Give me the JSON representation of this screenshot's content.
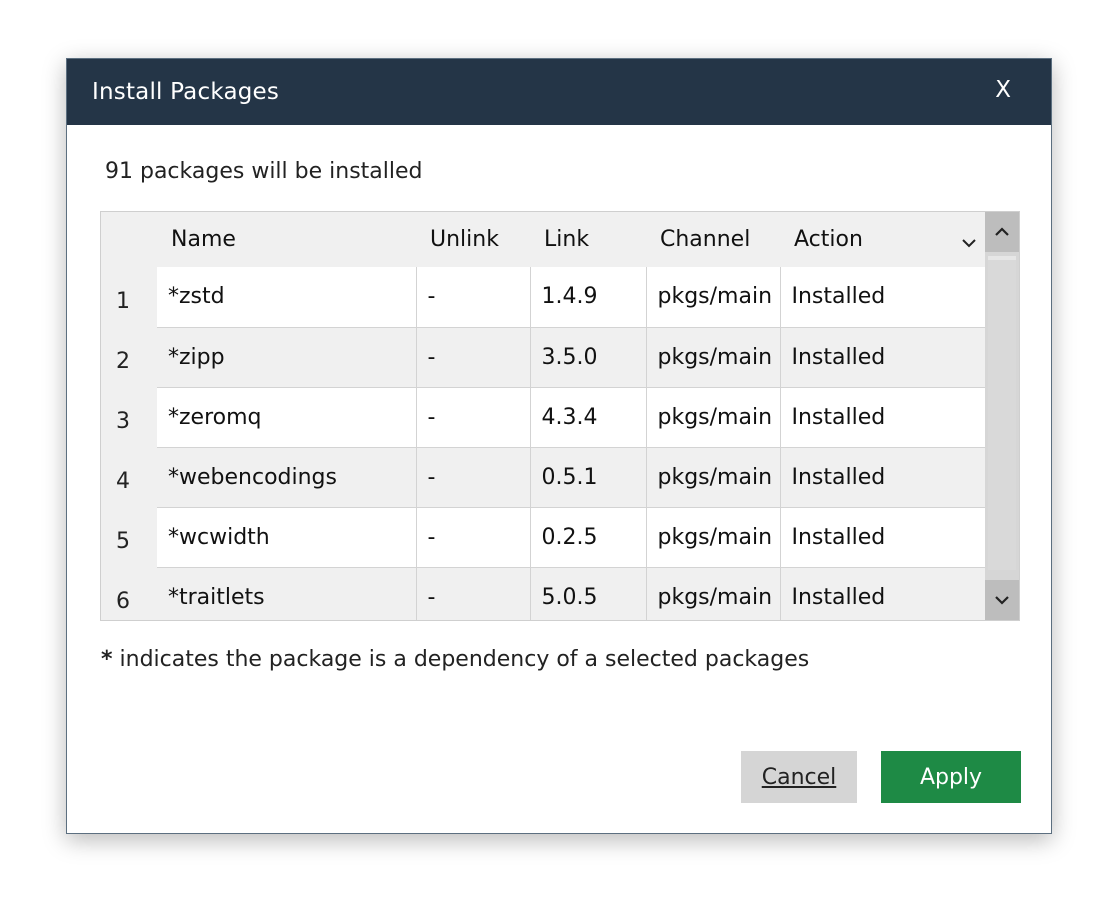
{
  "dialog": {
    "title": "Install Packages",
    "close_label": "X",
    "summary": "91 packages will be installed"
  },
  "table": {
    "columns": [
      "Name",
      "Unlink",
      "Link",
      "Channel",
      "Action"
    ],
    "rows": [
      {
        "num": "1",
        "name": "*zstd",
        "unlink": "-",
        "link": "1.4.9",
        "channel": "pkgs/main",
        "action": "Installed"
      },
      {
        "num": "2",
        "name": "*zipp",
        "unlink": "-",
        "link": "3.5.0",
        "channel": "pkgs/main",
        "action": "Installed"
      },
      {
        "num": "3",
        "name": "*zeromq",
        "unlink": "-",
        "link": "4.3.4",
        "channel": "pkgs/main",
        "action": "Installed"
      },
      {
        "num": "4",
        "name": "*webencodings",
        "unlink": "-",
        "link": "0.5.1",
        "channel": "pkgs/main",
        "action": "Installed"
      },
      {
        "num": "5",
        "name": "*wcwidth",
        "unlink": "-",
        "link": "0.2.5",
        "channel": "pkgs/main",
        "action": "Installed"
      },
      {
        "num": "6",
        "name": "*traitlets",
        "unlink": "-",
        "link": "5.0.5",
        "channel": "pkgs/main",
        "action": "Installed"
      }
    ]
  },
  "note": {
    "star": "*",
    "text": " indicates the package is a dependency of a selected packages"
  },
  "buttons": {
    "cancel": "Cancel",
    "apply": "Apply"
  },
  "colors": {
    "titlebar": "#243547",
    "apply": "#1e8a45",
    "cancel": "#d5d5d5"
  },
  "icons": {
    "close": "close-icon",
    "sort": "chevron-down-icon",
    "scroll_up": "chevron-up-icon",
    "scroll_down": "chevron-down-icon"
  }
}
